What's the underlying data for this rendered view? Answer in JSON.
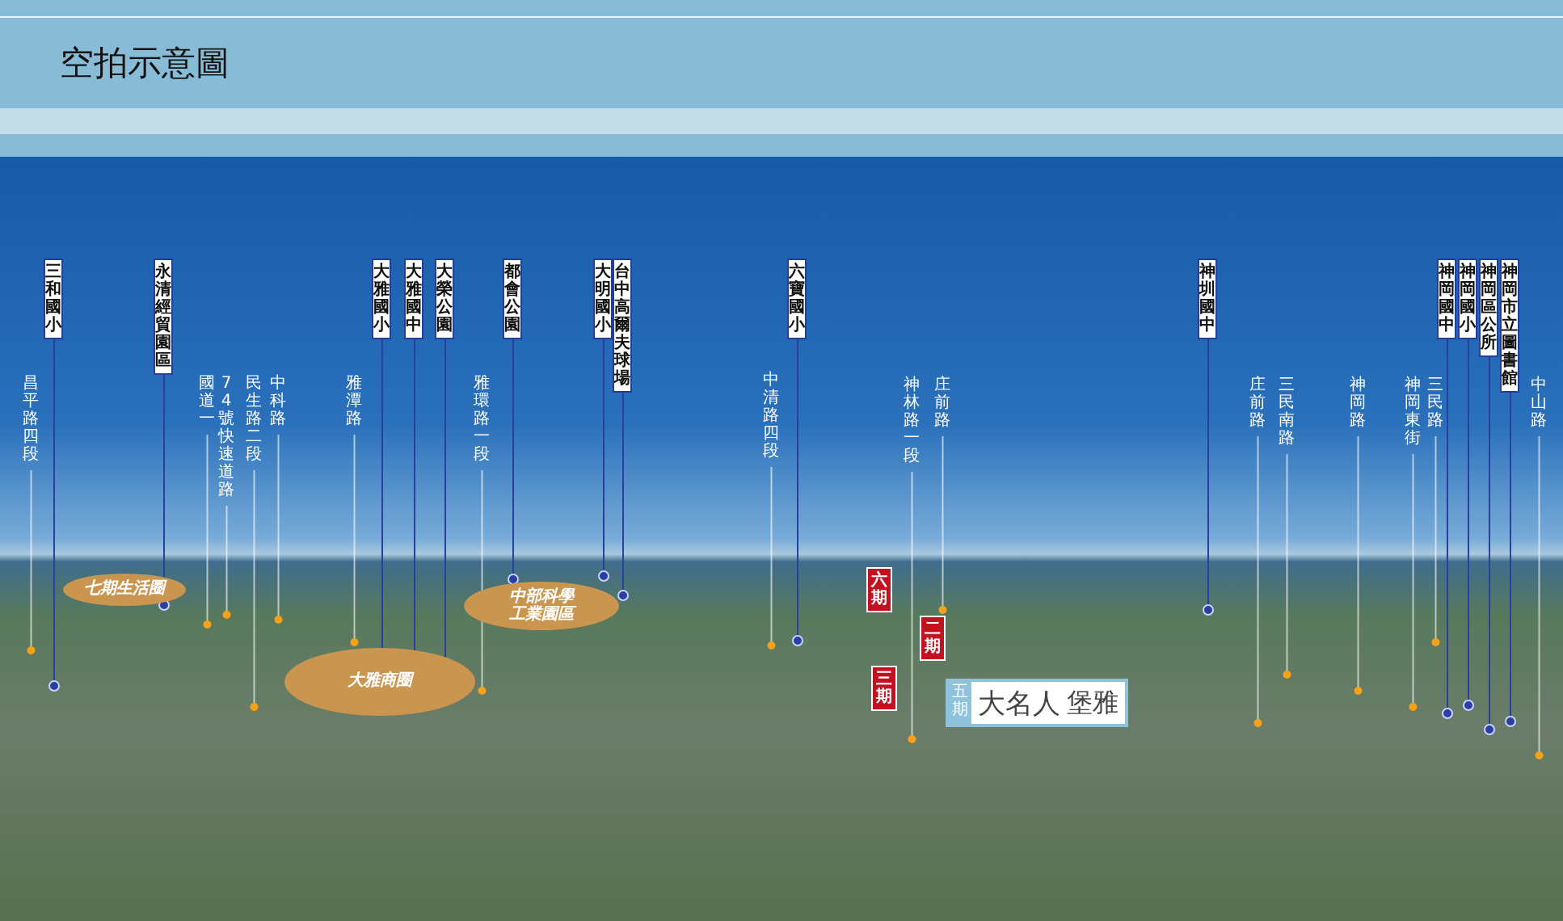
{
  "header": {
    "title": "空拍示意圖"
  },
  "aerial_view": {
    "landmarks": [
      "三和國小",
      "永清經貿園區",
      "大雅國小",
      "大雅國中",
      "大榮公園",
      "都會公園",
      "大明國小",
      "台中高爾夫球場",
      "六寶國小",
      "神圳國中",
      "神岡國中",
      "神岡國小",
      "神岡區公所",
      "神岡市立圖書館"
    ],
    "roads": [
      "昌平路四段",
      "國道一",
      "74號快速道路",
      "民生路二段",
      "中科路",
      "雅潭路",
      "雅環路一段",
      "中清路四段",
      "神林路一段",
      "庄前路",
      "庄前路",
      "三民南路",
      "神岡路",
      "神岡東街",
      "三民路",
      "中山路"
    ],
    "zones": [
      {
        "lines": [
          "七期生活圈"
        ]
      },
      {
        "lines": [
          "中部科學",
          "工業園區"
        ]
      },
      {
        "lines": [
          "大雅商圈"
        ]
      }
    ],
    "phases": [
      "六期",
      "二期",
      "三期"
    ],
    "project_sign": {
      "phase": "五期",
      "name": "大名人",
      "name_2": "堡雅"
    }
  }
}
